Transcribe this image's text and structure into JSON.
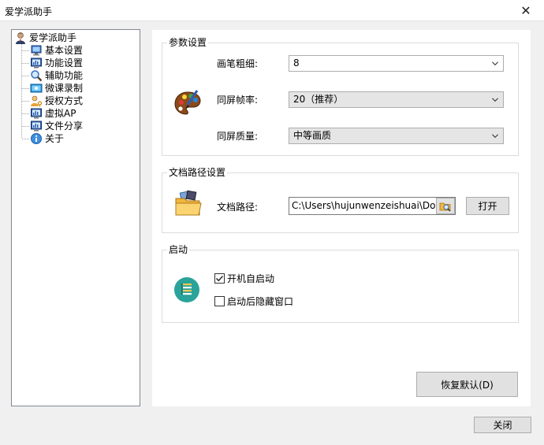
{
  "window": {
    "title": "爱学派助手",
    "close_glyph": "✕"
  },
  "tree": {
    "root": {
      "label": "爱学派助手",
      "icon": "user-icon"
    },
    "items": [
      {
        "label": "基本设置",
        "icon": "monitor-icon"
      },
      {
        "label": "功能设置",
        "icon": "chart-monitor-icon"
      },
      {
        "label": "辅助功能",
        "icon": "magnifier-icon"
      },
      {
        "label": "微课录制",
        "icon": "screen-record-icon"
      },
      {
        "label": "授权方式",
        "icon": "user-key-icon"
      },
      {
        "label": "虚拟AP",
        "icon": "chart-monitor-icon"
      },
      {
        "label": "文件分享",
        "icon": "chart-monitor-icon"
      },
      {
        "label": "关于",
        "icon": "info-icon"
      }
    ]
  },
  "params_group": {
    "title": "参数设置",
    "pen_label": "画笔粗细:",
    "pen_value": "8",
    "fps_label": "同屏帧率:",
    "fps_value": "20（推荐）",
    "quality_label": "同屏质量:",
    "quality_value": "中等画质"
  },
  "path_group": {
    "title": "文档路径设置",
    "path_label": "文档路径:",
    "path_value": "C:\\Users\\hujunwenzeishuai\\Documents",
    "open_label": "打开"
  },
  "startup_group": {
    "title": "启动",
    "autostart_label": "开机自启动",
    "autostart_checked": true,
    "hide_label": "启动后隐藏窗口",
    "hide_checked": false
  },
  "buttons": {
    "restore_default": "恢复默认(D)",
    "close": "关闭"
  }
}
